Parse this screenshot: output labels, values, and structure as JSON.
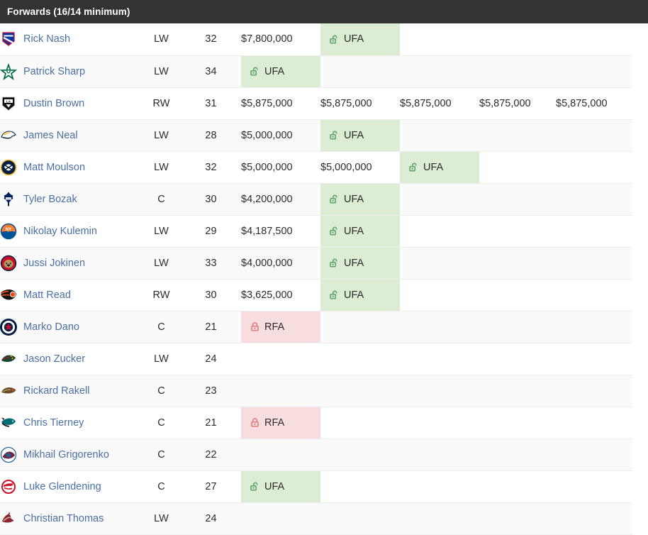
{
  "section": {
    "title": "Forwards (16/14 minimum)",
    "header_bg": "#333333"
  },
  "legend": {
    "ufa_label": "UFA",
    "rfa_label": "RFA",
    "ufa_bg": "#dcedd3",
    "rfa_bg": "#f7dddd",
    "ufa_icon": "unlock-icon",
    "rfa_icon": "lock-icon",
    "link_color": "#4a6fa5"
  },
  "columns": {
    "count": 5,
    "widths": [
      112,
      112,
      110,
      108,
      108
    ]
  },
  "rows": [
    {
      "name": "Rick Nash",
      "team": "NYR",
      "pos": "LW",
      "age": "32",
      "cells": [
        {
          "type": "money",
          "text": "$7,800,000"
        },
        {
          "type": "ufa",
          "text": "UFA"
        },
        {
          "type": "empty",
          "text": ""
        },
        {
          "type": "empty",
          "text": ""
        },
        {
          "type": "empty",
          "text": ""
        }
      ]
    },
    {
      "name": "Patrick Sharp",
      "team": "DAL",
      "pos": "LW",
      "age": "34",
      "cells": [
        {
          "type": "ufa",
          "text": "UFA"
        },
        {
          "type": "empty",
          "text": ""
        },
        {
          "type": "empty",
          "text": ""
        },
        {
          "type": "empty",
          "text": ""
        },
        {
          "type": "empty",
          "text": ""
        }
      ]
    },
    {
      "name": "Dustin Brown",
      "team": "LAK",
      "pos": "RW",
      "age": "31",
      "cells": [
        {
          "type": "money",
          "text": "$5,875,000"
        },
        {
          "type": "money",
          "text": "$5,875,000"
        },
        {
          "type": "money",
          "text": "$5,875,000"
        },
        {
          "type": "money",
          "text": "$5,875,000"
        },
        {
          "type": "money",
          "text": "$5,875,000"
        }
      ]
    },
    {
      "name": "James Neal",
      "team": "NSH",
      "pos": "LW",
      "age": "28",
      "cells": [
        {
          "type": "money",
          "text": "$5,000,000"
        },
        {
          "type": "ufa",
          "text": "UFA"
        },
        {
          "type": "empty",
          "text": ""
        },
        {
          "type": "empty",
          "text": ""
        },
        {
          "type": "empty",
          "text": ""
        }
      ]
    },
    {
      "name": "Matt Moulson",
      "team": "BUF",
      "pos": "LW",
      "age": "32",
      "cells": [
        {
          "type": "money",
          "text": "$5,000,000"
        },
        {
          "type": "money",
          "text": "$5,000,000"
        },
        {
          "type": "ufa",
          "text": "UFA"
        },
        {
          "type": "empty",
          "text": ""
        },
        {
          "type": "empty",
          "text": ""
        }
      ]
    },
    {
      "name": "Tyler Bozak",
      "team": "TOR",
      "pos": "C",
      "age": "30",
      "cells": [
        {
          "type": "money",
          "text": "$4,200,000"
        },
        {
          "type": "ufa",
          "text": "UFA"
        },
        {
          "type": "empty",
          "text": ""
        },
        {
          "type": "empty",
          "text": ""
        },
        {
          "type": "empty",
          "text": ""
        }
      ]
    },
    {
      "name": "Nikolay Kulemin",
      "team": "NYI",
      "pos": "LW",
      "age": "29",
      "cells": [
        {
          "type": "money",
          "text": "$4,187,500"
        },
        {
          "type": "ufa",
          "text": "UFA"
        },
        {
          "type": "empty",
          "text": ""
        },
        {
          "type": "empty",
          "text": ""
        },
        {
          "type": "empty",
          "text": ""
        }
      ]
    },
    {
      "name": "Jussi Jokinen",
      "team": "FLA",
      "pos": "LW",
      "age": "33",
      "cells": [
        {
          "type": "money",
          "text": "$4,000,000"
        },
        {
          "type": "ufa",
          "text": "UFA"
        },
        {
          "type": "empty",
          "text": ""
        },
        {
          "type": "empty",
          "text": ""
        },
        {
          "type": "empty",
          "text": ""
        }
      ]
    },
    {
      "name": "Matt Read",
      "team": "PHI",
      "pos": "RW",
      "age": "30",
      "cells": [
        {
          "type": "money",
          "text": "$3,625,000"
        },
        {
          "type": "ufa",
          "text": "UFA"
        },
        {
          "type": "empty",
          "text": ""
        },
        {
          "type": "empty",
          "text": ""
        },
        {
          "type": "empty",
          "text": ""
        }
      ]
    },
    {
      "name": "Marko Dano",
      "team": "WPG",
      "pos": "C",
      "age": "21",
      "cells": [
        {
          "type": "rfa",
          "text": "RFA"
        },
        {
          "type": "empty",
          "text": ""
        },
        {
          "type": "empty",
          "text": ""
        },
        {
          "type": "empty",
          "text": ""
        },
        {
          "type": "empty",
          "text": ""
        }
      ]
    },
    {
      "name": "Jason Zucker",
      "team": "MIN",
      "pos": "LW",
      "age": "24",
      "cells": [
        {
          "type": "empty",
          "text": ""
        },
        {
          "type": "empty",
          "text": ""
        },
        {
          "type": "empty",
          "text": ""
        },
        {
          "type": "empty",
          "text": ""
        },
        {
          "type": "empty",
          "text": ""
        }
      ]
    },
    {
      "name": "Rickard Rakell",
      "team": "ANA",
      "pos": "C",
      "age": "23",
      "cells": [
        {
          "type": "empty",
          "text": ""
        },
        {
          "type": "empty",
          "text": ""
        },
        {
          "type": "empty",
          "text": ""
        },
        {
          "type": "empty",
          "text": ""
        },
        {
          "type": "empty",
          "text": ""
        }
      ]
    },
    {
      "name": "Chris Tierney",
      "team": "SJS",
      "pos": "C",
      "age": "21",
      "cells": [
        {
          "type": "rfa",
          "text": "RFA"
        },
        {
          "type": "empty",
          "text": ""
        },
        {
          "type": "empty",
          "text": ""
        },
        {
          "type": "empty",
          "text": ""
        },
        {
          "type": "empty",
          "text": ""
        }
      ]
    },
    {
      "name": "Mikhail Grigorenko",
      "team": "COL",
      "pos": "C",
      "age": "22",
      "cells": [
        {
          "type": "empty",
          "text": ""
        },
        {
          "type": "empty",
          "text": ""
        },
        {
          "type": "empty",
          "text": ""
        },
        {
          "type": "empty",
          "text": ""
        },
        {
          "type": "empty",
          "text": ""
        }
      ]
    },
    {
      "name": "Luke Glendening",
      "team": "DET",
      "pos": "C",
      "age": "27",
      "cells": [
        {
          "type": "ufa",
          "text": "UFA"
        },
        {
          "type": "empty",
          "text": ""
        },
        {
          "type": "empty",
          "text": ""
        },
        {
          "type": "empty",
          "text": ""
        },
        {
          "type": "empty",
          "text": ""
        }
      ]
    },
    {
      "name": "Christian Thomas",
      "team": "ARI",
      "pos": "LW",
      "age": "24",
      "cells": [
        {
          "type": "empty",
          "text": ""
        },
        {
          "type": "empty",
          "text": ""
        },
        {
          "type": "empty",
          "text": ""
        },
        {
          "type": "empty",
          "text": ""
        },
        {
          "type": "empty",
          "text": ""
        }
      ]
    }
  ]
}
